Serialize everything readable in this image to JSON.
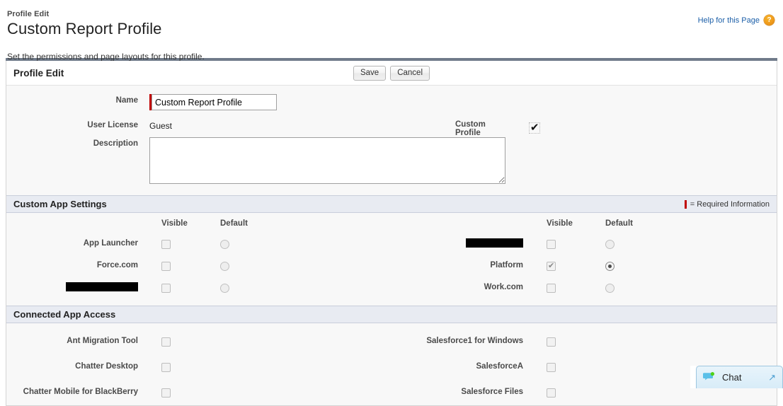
{
  "header": {
    "breadcrumb": "Profile Edit",
    "title": "Custom Report Profile",
    "description": "Set the permissions and page layouts for this profile.",
    "help_link": "Help for this Page",
    "help_icon_glyph": "?"
  },
  "panel": {
    "title": "Profile Edit",
    "save_label": "Save",
    "cancel_label": "Cancel"
  },
  "form": {
    "name_label": "Name",
    "name_value": "Custom Report Profile",
    "user_license_label": "User License",
    "user_license_value": "Guest",
    "custom_profile_label": "Custom Profile",
    "custom_profile_checkmark": "✔",
    "description_label": "Description",
    "description_value": ""
  },
  "custom_app_settings": {
    "section_title": "Custom App Settings",
    "required_legend": "= Required Information",
    "col_visible": "Visible",
    "col_default": "Default",
    "left_apps": [
      {
        "label": "App Launcher",
        "redacted": false,
        "visible": false,
        "default": false
      },
      {
        "label": "Force.com",
        "redacted": false,
        "visible": false,
        "default": false
      },
      {
        "label": "",
        "redacted": true,
        "visible": false,
        "default": false
      }
    ],
    "right_apps": [
      {
        "label": "",
        "redacted": true,
        "visible": false,
        "default": false
      },
      {
        "label": "Platform",
        "redacted": false,
        "visible": true,
        "default": true
      },
      {
        "label": "Work.com",
        "redacted": false,
        "visible": false,
        "default": false
      }
    ]
  },
  "connected_app_access": {
    "section_title": "Connected App Access",
    "left_apps": [
      {
        "label": "Ant Migration Tool",
        "checked": false
      },
      {
        "label": "Chatter Desktop",
        "checked": false
      },
      {
        "label": "Chatter Mobile for BlackBerry",
        "checked": false
      }
    ],
    "right_apps": [
      {
        "label": "Salesforce1 for Windows",
        "checked": false
      },
      {
        "label": "SalesforceA",
        "checked": false
      },
      {
        "label": "Salesforce Files",
        "checked": false
      }
    ]
  },
  "chat_widget": {
    "label": "Chat",
    "expand_glyph": "↗",
    "bubble_color": "#5bc0e8",
    "status_color": "#4fd118"
  }
}
